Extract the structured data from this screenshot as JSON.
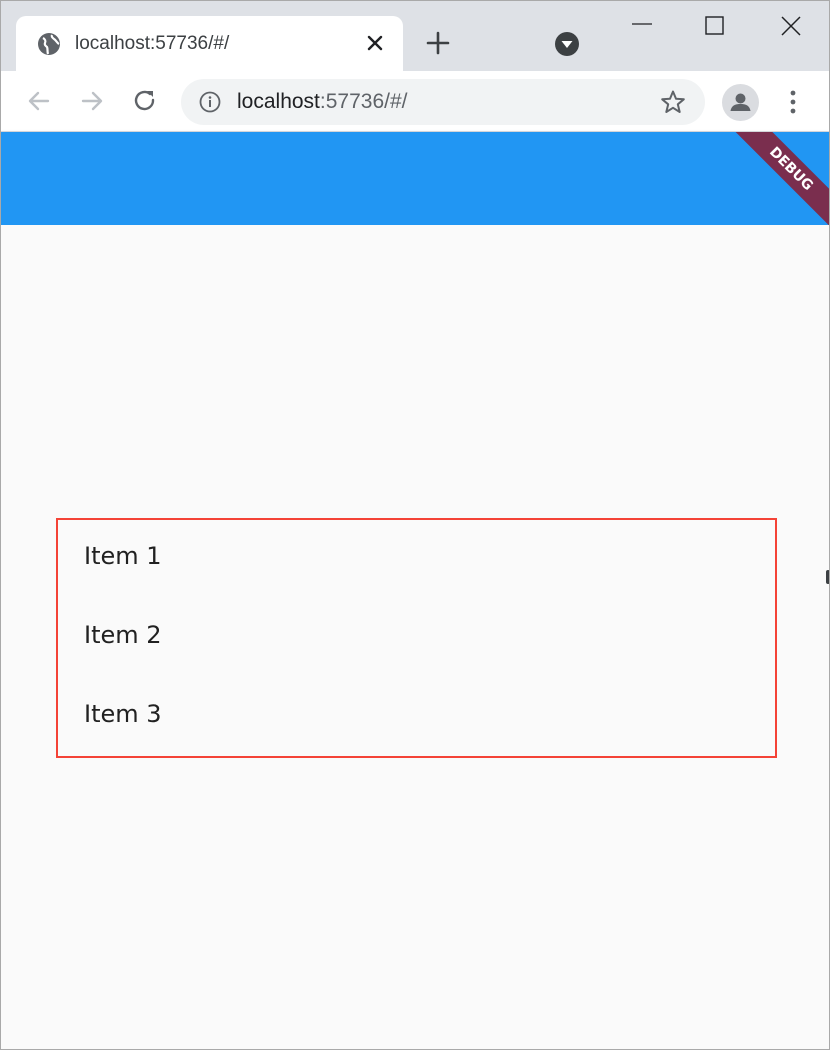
{
  "browser": {
    "tab": {
      "title": "localhost:57736/#/"
    },
    "omnibox": {
      "host": "localhost",
      "rest": ":57736/#/"
    }
  },
  "app": {
    "debug_banner": "DEBUG",
    "list": {
      "items": [
        {
          "label": "Item 1"
        },
        {
          "label": "Item 2"
        },
        {
          "label": "Item 3"
        }
      ]
    }
  },
  "colors": {
    "appbar": "#2196f3",
    "list_border": "#f44336",
    "debug_banner": "#7a2e4e",
    "background": "#fafafa"
  }
}
